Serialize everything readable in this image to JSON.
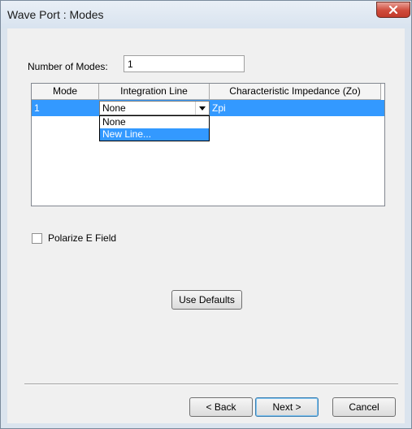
{
  "window": {
    "title": "Wave Port : Modes"
  },
  "form": {
    "number_of_modes_label": "Number of Modes:",
    "number_of_modes_value": "1"
  },
  "grid": {
    "columns": [
      "Mode",
      "Integration Line",
      "Characteristic Impedance (Zo)"
    ],
    "rows": [
      {
        "mode": "1",
        "integration_line": "None",
        "impedance": "Zpi"
      }
    ],
    "dropdown_options": [
      "None",
      "New Line..."
    ],
    "dropdown_highlighted": "New Line..."
  },
  "polarize": {
    "label": "Polarize E Field",
    "checked": false
  },
  "buttons": {
    "use_defaults": "Use Defaults",
    "back": "< Back",
    "next": "Next >",
    "cancel": "Cancel"
  },
  "colors": {
    "selection": "#3399ff",
    "dialog_bg": "#f0f0f0",
    "close_button": "#cf4b3b"
  },
  "icons": [
    "close-icon",
    "dropdown-arrow-icon"
  ]
}
